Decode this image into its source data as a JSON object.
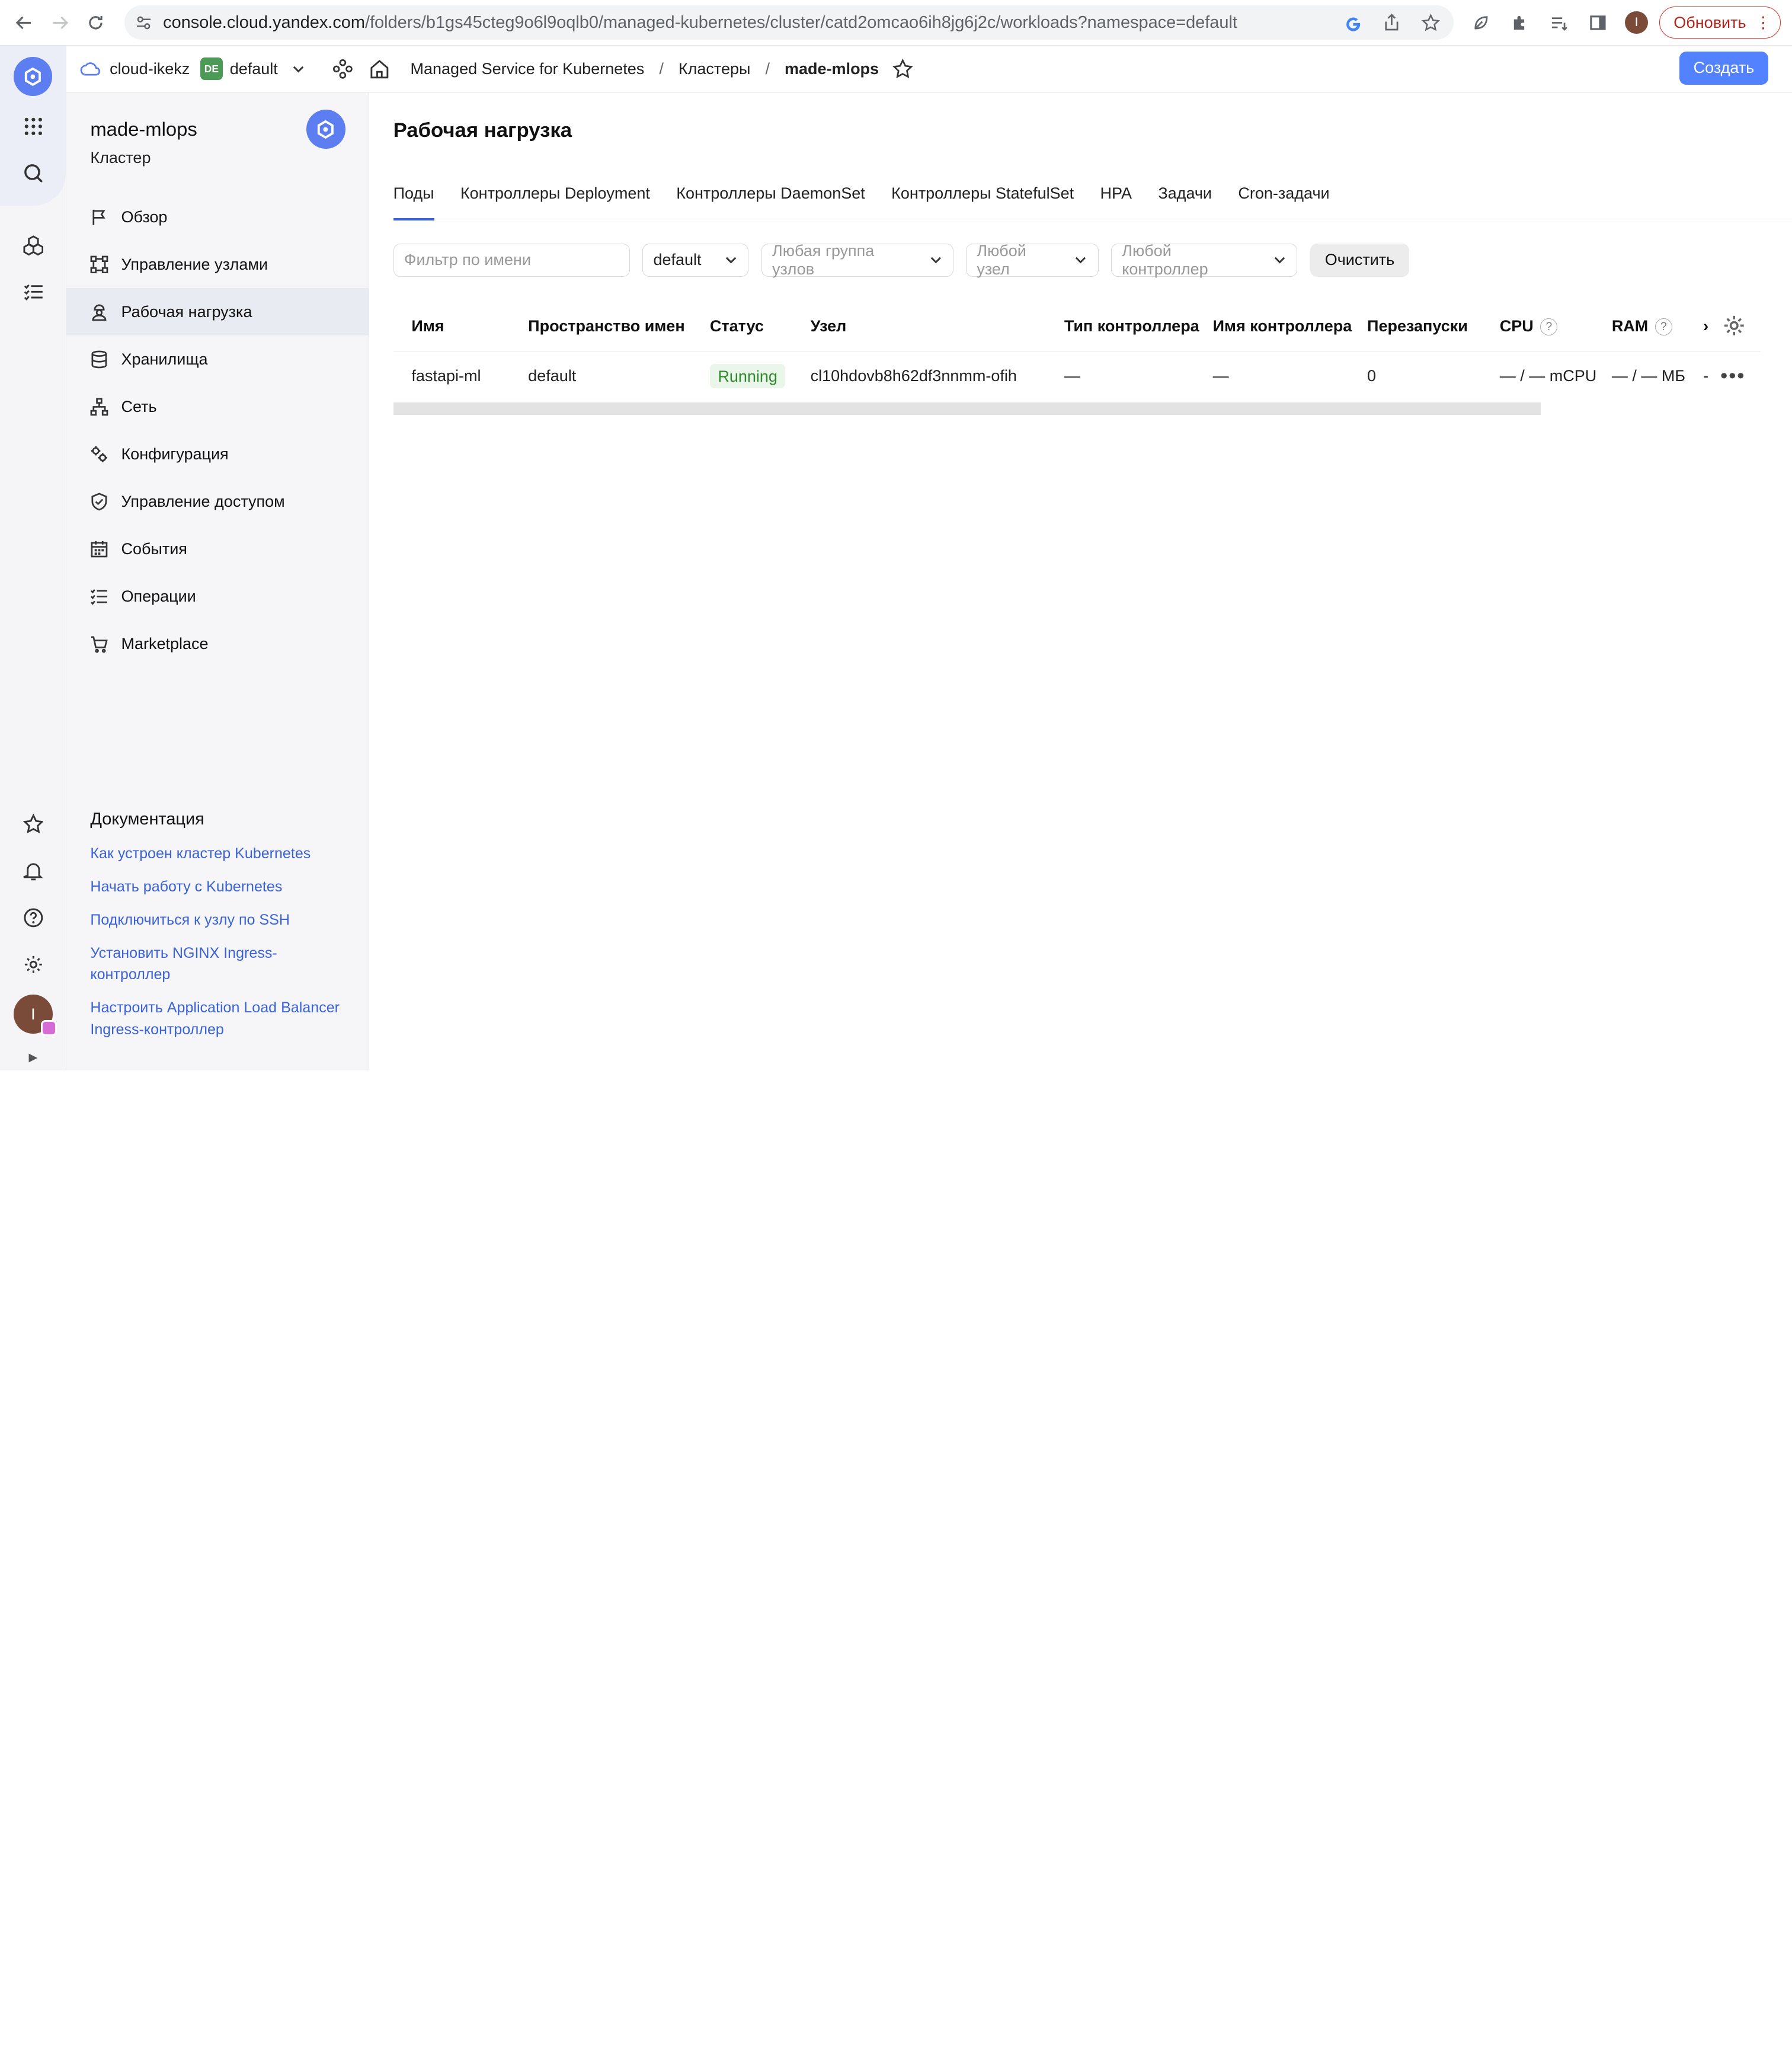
{
  "browser": {
    "url_host": "console.cloud.yandex.com",
    "url_path": "/folders/b1gs45cteg9o6l9oqlb0/managed-kubernetes/cluster/catd2omcao6ih8jg6j2c/workloads?namespace=default",
    "profile_initial": "I",
    "update_label": "Обновить"
  },
  "header": {
    "cloud": "cloud-ikekz",
    "folder_badge": "DE",
    "folder": "default",
    "breadcrumbs": [
      "Managed Service for Kubernetes",
      "Кластеры",
      "made-mlops"
    ],
    "separator": "/",
    "create_label": "Создать"
  },
  "sidebar": {
    "cluster_name": "made-mlops",
    "cluster_type": "Кластер",
    "items": [
      {
        "label": "Обзор",
        "icon": "flag-icon"
      },
      {
        "label": "Управление узлами",
        "icon": "nodes-icon"
      },
      {
        "label": "Рабочая нагрузка",
        "icon": "worker-icon",
        "active": true
      },
      {
        "label": "Хранилища",
        "icon": "database-icon"
      },
      {
        "label": "Сеть",
        "icon": "network-icon"
      },
      {
        "label": "Конфигурация",
        "icon": "config-icon"
      },
      {
        "label": "Управление доступом",
        "icon": "shield-icon"
      },
      {
        "label": "События",
        "icon": "calendar-icon"
      },
      {
        "label": "Операции",
        "icon": "list-icon"
      },
      {
        "label": "Marketplace",
        "icon": "cart-icon"
      }
    ],
    "docs_title": "Документация",
    "docs": [
      "Как устроен кластер Kubernetes",
      "Начать работу с Kubernetes",
      "Подключиться к узлу по SSH",
      "Установить NGINX Ingress-контроллер",
      "Настроить Application Load Balancer Ingress-контроллер"
    ]
  },
  "main": {
    "title": "Рабочая нагрузка",
    "tabs": [
      "Поды",
      "Контроллеры Deployment",
      "Контроллеры DaemonSet",
      "Контроллеры StatefulSet",
      "HPA",
      "Задачи",
      "Cron-задачи"
    ],
    "filters": {
      "name_placeholder": "Фильтр по имени",
      "namespace": "default",
      "node_group": "Любая группа узлов",
      "node": "Любой узел",
      "controller": "Любой контроллер",
      "clear": "Очистить"
    },
    "columns": [
      "Имя",
      "Пространство имен",
      "Статус",
      "Узел",
      "Тип контроллера",
      "Имя контроллера",
      "Перезапуски",
      "CPU",
      "RAM",
      "›"
    ],
    "rows": [
      {
        "name": "fastapi-ml",
        "namespace": "default",
        "status": "Running",
        "node": "cl10hdovb8h62df3nnmm-ofih",
        "controller_type": "—",
        "controller_name": "—",
        "restarts": "0",
        "cpu": "— / — mCPU",
        "ram": "— / — МБ",
        "extra": "-"
      }
    ]
  },
  "colors": {
    "accent": "#5282ff",
    "link": "#3b63d8",
    "running_bg": "#e9f6e9",
    "running_text": "#2f8a2f"
  }
}
